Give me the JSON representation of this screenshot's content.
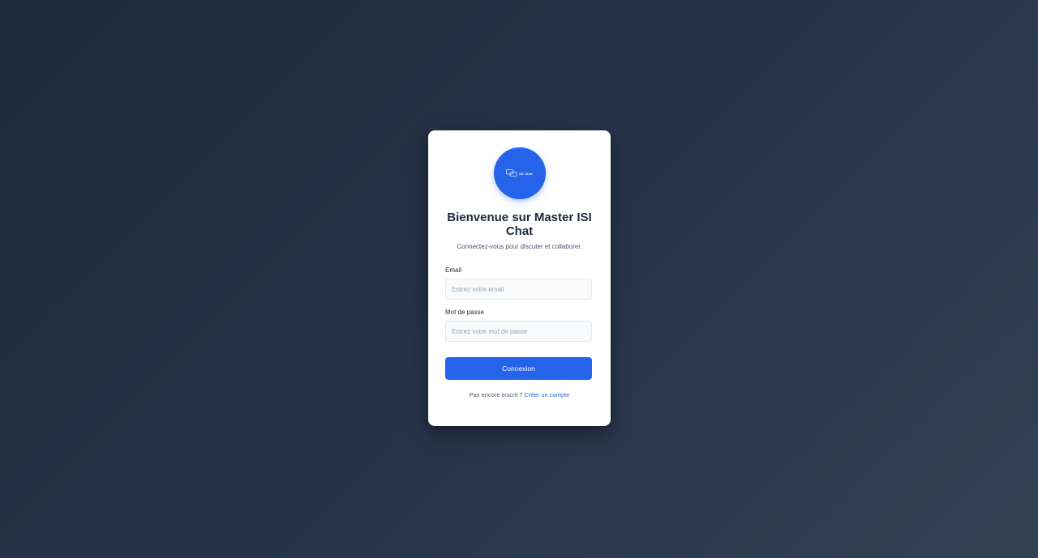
{
  "login": {
    "logo": {
      "icon": "chat-bubbles-icon",
      "text": "ISI Chat"
    },
    "title": "Bienvenue sur Master ISI Chat",
    "subtitle": "Connectez-vous pour discuter et collaborer.",
    "email": {
      "label": "Email",
      "placeholder": "Entrez votre email",
      "value": ""
    },
    "password": {
      "label": "Mot de passe",
      "placeholder": "Entrez votre mot de passe",
      "value": ""
    },
    "submit_label": "Connexion",
    "footer": {
      "prompt": "Pas encore inscrit ?",
      "link_label": "Créer un compte"
    }
  },
  "colors": {
    "accent": "#2563eb",
    "background_start": "#1e293b",
    "background_end": "#334155",
    "card": "#ffffff",
    "heading": "#1e293b"
  }
}
